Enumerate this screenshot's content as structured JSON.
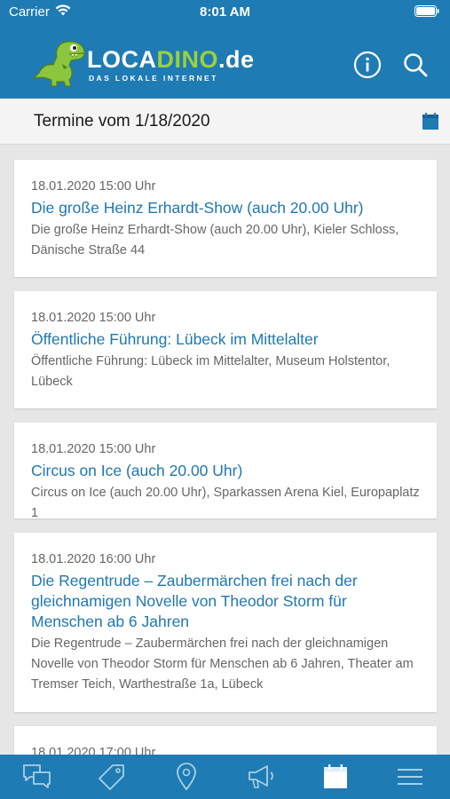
{
  "status": {
    "carrier": "Carrier",
    "time": "8:01 AM"
  },
  "header": {
    "logo_main_1": "LOCA",
    "logo_main_2": "DINO",
    "logo_main_3": ".de",
    "logo_sub": "DAS LOKALE INTERNET",
    "info_icon": "info-icon",
    "search_icon": "search-icon"
  },
  "subheader": {
    "title": "Termine vom 1/18/2020",
    "icon": "calendar-icon"
  },
  "events": [
    {
      "date": "18.01.2020 15:00 Uhr",
      "title": "Die große Heinz Erhardt-Show (auch 20.00 Uhr)",
      "desc": "Die große Heinz Erhardt-Show (auch 20.00 Uhr), Kieler Schloss, Dänische Straße 44"
    },
    {
      "date": "18.01.2020 15:00 Uhr",
      "title": "Öffentliche Führung: Lübeck im Mittelalter",
      "desc": "Öffentliche Führung: Lübeck im Mittelalter, Museum Holstentor, Lübeck"
    },
    {
      "date": "18.01.2020 15:00 Uhr",
      "title": "Circus on Ice (auch 20.00 Uhr)",
      "desc": "Circus on Ice (auch 20.00 Uhr), Sparkassen Arena Kiel, Europaplatz 1"
    },
    {
      "date": "18.01.2020 16:00 Uhr",
      "title": "Die Regentrude – Zaubermärchen frei nach der gleichnamigen Novelle von Theodor Storm für Menschen ab 6 Jahren",
      "desc": "Die Regentrude – Zaubermärchen frei nach der gleichnamigen Novelle von Theodor Storm für Menschen ab 6 Jahren, Theater am Tremser Teich, Warthestraße 1a, Lübeck"
    },
    {
      "date": "18.01.2020 17:00 Uhr",
      "title": "",
      "desc": ""
    }
  ],
  "tabbar": {
    "tabs": [
      "chat-icon",
      "tag-icon",
      "location-pin-icon",
      "megaphone-icon",
      "calendar-icon",
      "menu-icon"
    ],
    "active_index": 4
  },
  "colors": {
    "brand_blue": "#1f7bb3",
    "link_blue": "#1f77b0",
    "dino_green": "#9bd13c",
    "background": "#e6e6e6"
  }
}
